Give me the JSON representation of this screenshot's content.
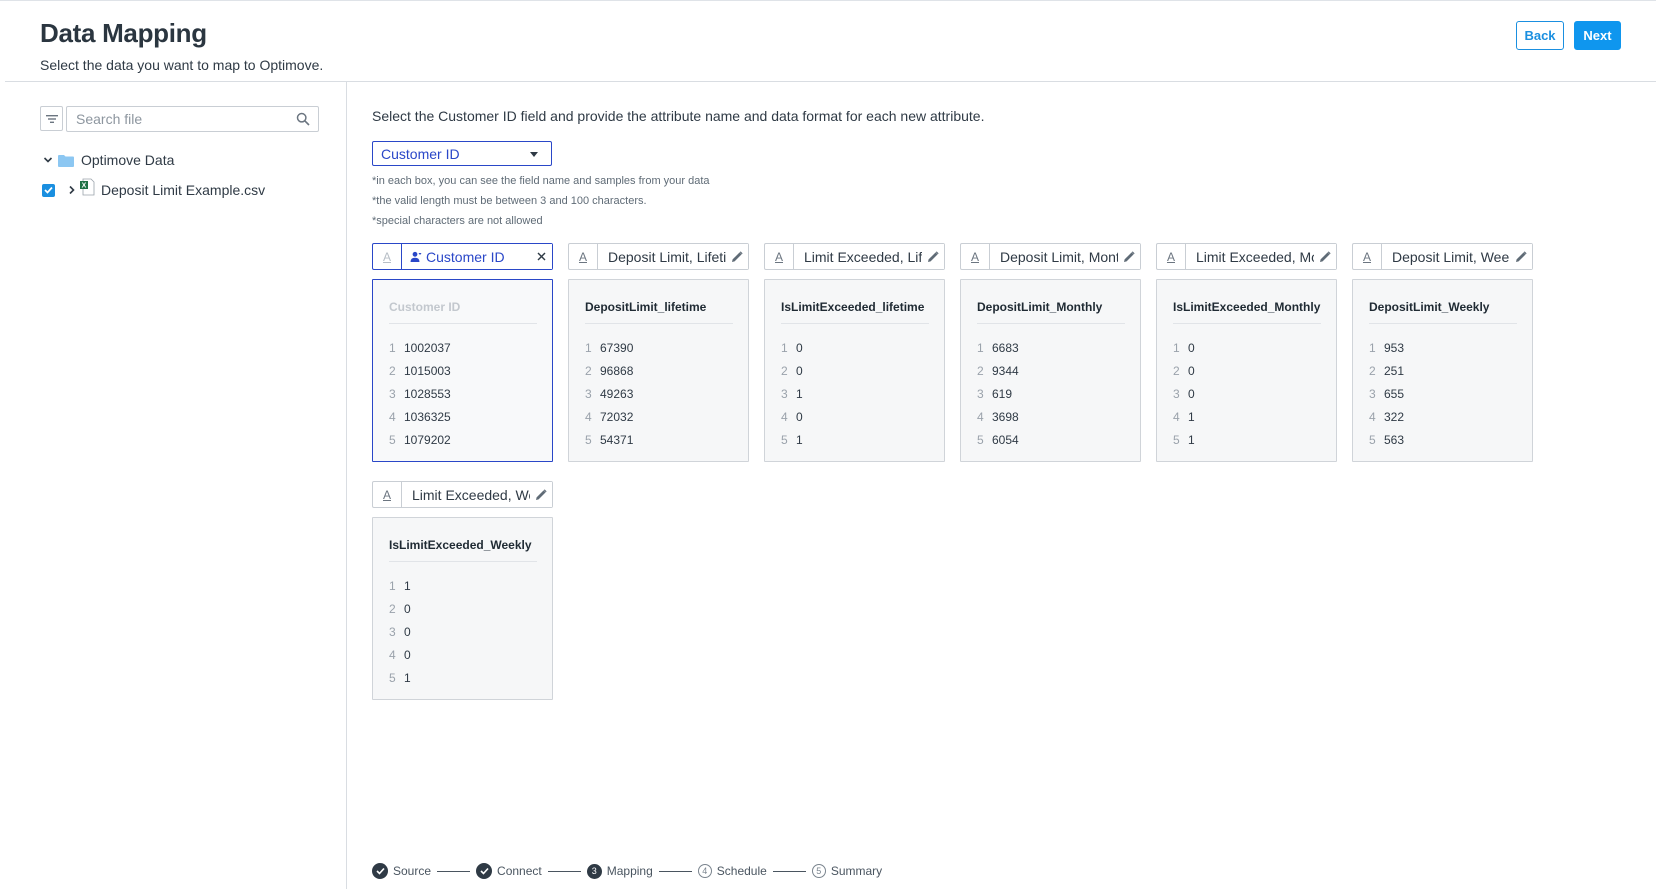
{
  "header": {
    "title": "Data Mapping",
    "subtitle": "Select the data you want to map to Optimove.",
    "back_label": "Back",
    "next_label": "Next"
  },
  "sidebar": {
    "search_placeholder": "Search file",
    "tree": {
      "folder_label": "Optimove Data",
      "file_label": "Deposit Limit Example.csv",
      "file_checked": true
    }
  },
  "main": {
    "instructions": "Select the Customer ID field and provide the attribute name and data format for each new attribute.",
    "id_select_value": "Customer ID",
    "notes": [
      "*in each box, you can see the field name and samples from your data",
      "*the valid length must be between 3 and 100 characters.",
      "*special characters are not allowed"
    ],
    "type_icon": "A",
    "columns": [
      {
        "attr_name": "Customer ID",
        "field": "Customer ID",
        "selected": true,
        "samples": [
          "1002037",
          "1015003",
          "1028553",
          "1036325",
          "1079202"
        ]
      },
      {
        "attr_name": "Deposit Limit, Lifetime",
        "field": "DepositLimit_lifetime",
        "selected": false,
        "samples": [
          "67390",
          "96868",
          "49263",
          "72032",
          "54371"
        ]
      },
      {
        "attr_name": "Limit Exceeded, Lifetime",
        "field": "IsLimitExceeded_lifetime",
        "selected": false,
        "samples": [
          "0",
          "0",
          "1",
          "0",
          "1"
        ]
      },
      {
        "attr_name": "Deposit Limit, Monthly",
        "field": "DepositLimit_Monthly",
        "selected": false,
        "samples": [
          "6683",
          "9344",
          "619",
          "3698",
          "6054"
        ]
      },
      {
        "attr_name": "Limit Exceeded, Monthly",
        "field": "IsLimitExceeded_Monthly",
        "selected": false,
        "samples": [
          "0",
          "0",
          "0",
          "1",
          "1"
        ]
      },
      {
        "attr_name": "Deposit Limit, Weekly",
        "field": "DepositLimit_Weekly",
        "selected": false,
        "samples": [
          "953",
          "251",
          "655",
          "322",
          "563"
        ]
      },
      {
        "attr_name": "Limit Exceeded, Weekly",
        "field": "IsLimitExceeded_Weekly",
        "selected": false,
        "samples": [
          "1",
          "0",
          "0",
          "0",
          "1"
        ]
      }
    ]
  },
  "stepper": {
    "steps": [
      {
        "label": "Source",
        "state": "done",
        "number": "1"
      },
      {
        "label": "Connect",
        "state": "done",
        "number": "2"
      },
      {
        "label": "Mapping",
        "state": "current",
        "number": "3"
      },
      {
        "label": "Schedule",
        "state": "todo",
        "number": "4"
      },
      {
        "label": "Summary",
        "state": "todo",
        "number": "5"
      }
    ]
  },
  "colors": {
    "primary": "#0f96ee",
    "selected_border": "#2a47c8",
    "text": "#2f3a45"
  }
}
